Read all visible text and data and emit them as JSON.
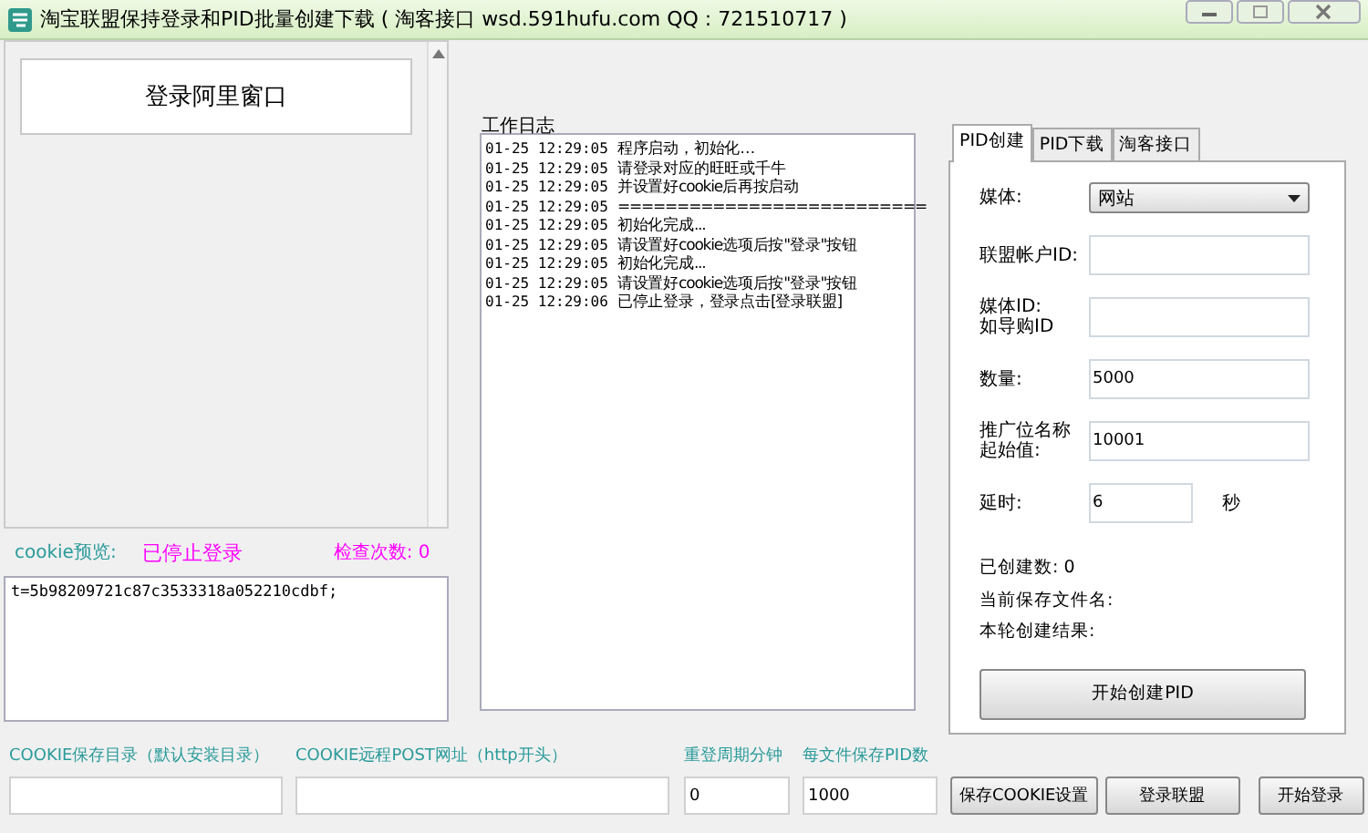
{
  "window": {
    "title": "淘宝联盟保持登录和PID批量创建下载 ( 淘客接口 wsd.591hufu.com  QQ : 721510717 )"
  },
  "login_button": "登录阿里窗口",
  "status": {
    "cookie_label": "cookie预览:",
    "login_state": "已停止登录",
    "check_count": "检查次数: 0"
  },
  "cookie_text": "t=5b98209721c87c3533318a052210cdbf;",
  "log": {
    "title": "工作日志",
    "entries": [
      {
        "time": "01-25 12:29:05",
        "message": "程序启动，初始化…"
      },
      {
        "time": "01-25 12:29:05",
        "message": "请登录对应的旺旺或千牛"
      },
      {
        "time": "01-25 12:29:05",
        "message": "并设置好cookie后再按启动"
      },
      {
        "time": "01-25 12:29:05",
        "message": "=========================="
      },
      {
        "time": "01-25 12:29:05",
        "message": "初始化完成..."
      },
      {
        "time": "01-25 12:29:05",
        "message": "请设置好cookie选项后按\"登录\"按钮"
      },
      {
        "time": "01-25 12:29:05",
        "message": "初始化完成..."
      },
      {
        "time": "01-25 12:29:05",
        "message": "请设置好cookie选项后按\"登录\"按钮"
      },
      {
        "time": "01-25 12:29:06",
        "message": "已停止登录，登录点击[登录联盟]"
      }
    ]
  },
  "tabs": [
    {
      "label": "PID创建",
      "selected": true
    },
    {
      "label": "PID下载",
      "selected": false
    },
    {
      "label": "淘客接口",
      "selected": false
    }
  ],
  "form": {
    "fields": [
      {
        "kind": "select",
        "label": "媒体:",
        "value": "网站"
      },
      {
        "kind": "text",
        "label": "联盟帐户ID:"
      },
      {
        "kind": "text",
        "label_lines": [
          "媒体ID:",
          "如导购ID"
        ]
      },
      {
        "kind": "text",
        "label": "数量:",
        "value": "5000"
      },
      {
        "kind": "text",
        "label_lines": [
          "推广位名称",
          "起始值:"
        ],
        "value": "10001"
      },
      {
        "kind": "short",
        "label": "延时:",
        "value": "6",
        "unit": "秒"
      }
    ],
    "info": [
      "已创建数: 0",
      "当前保存文件名:",
      "本轮创建结果:"
    ],
    "create_button": "开始创建PID"
  },
  "bottom": {
    "fields": [
      {
        "label": "COOKIE保存目录（默认安装目录）"
      },
      {
        "label": "COOKIE远程POST网址（http开头）"
      },
      {
        "label": "重登周期分钟",
        "value": "0"
      },
      {
        "label": "每文件保存PID数",
        "value": "1000"
      }
    ],
    "buttons": [
      "保存COOKIE设置",
      "登录联盟",
      "开始登录"
    ]
  }
}
